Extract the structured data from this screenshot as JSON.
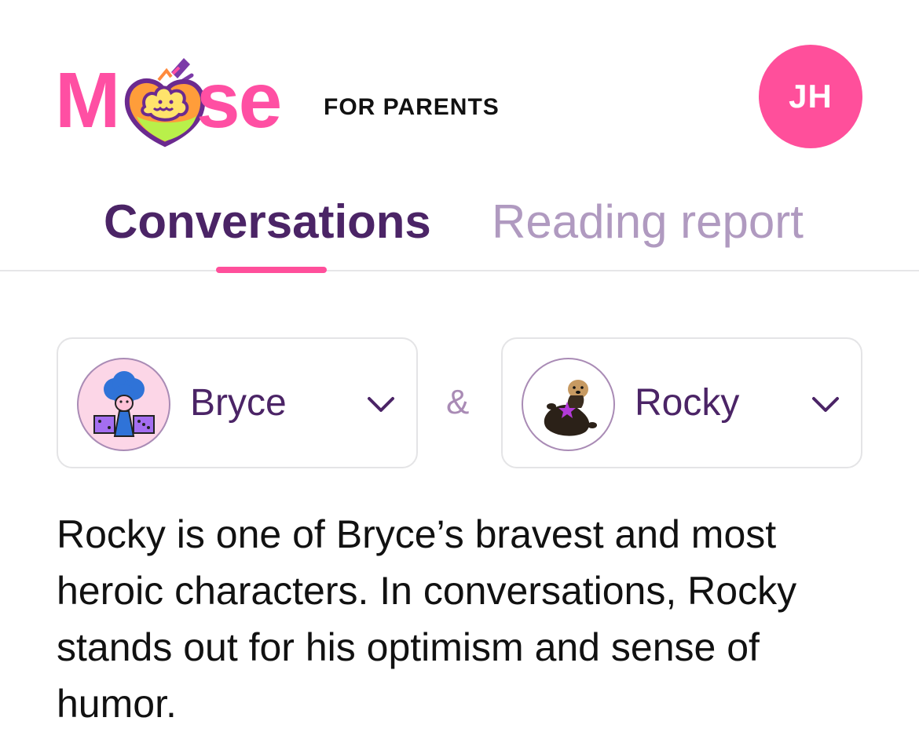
{
  "brand": {
    "logo_text_start": "M",
    "logo_text_end": "se",
    "logo_icon": "moose-heart-logo-icon",
    "subtitle": "FOR PARENTS",
    "pink": "#ff4fa3"
  },
  "user": {
    "initials": "JH",
    "avatar_color": "#ff4f9b"
  },
  "tabs": [
    {
      "label": "Conversations",
      "active": true
    },
    {
      "label": "Reading report",
      "active": false
    }
  ],
  "selectors": {
    "child": {
      "name": "Bryce",
      "avatar_icon": "blue-character-avatar-icon",
      "dropdown_icon": "chevron-down-icon"
    },
    "separator": "&",
    "character": {
      "name": "Rocky",
      "avatar_icon": "otter-plush-avatar-icon",
      "dropdown_icon": "chevron-down-icon"
    }
  },
  "description": "Rocky is one of Bryce’s bravest and most heroic characters. In conversations, Rocky stands out for his optimism and sense of humor.",
  "colors": {
    "accent_purple": "#4b2466",
    "muted_purple": "#b09ac0",
    "accent_pink": "#ff4f9b"
  }
}
